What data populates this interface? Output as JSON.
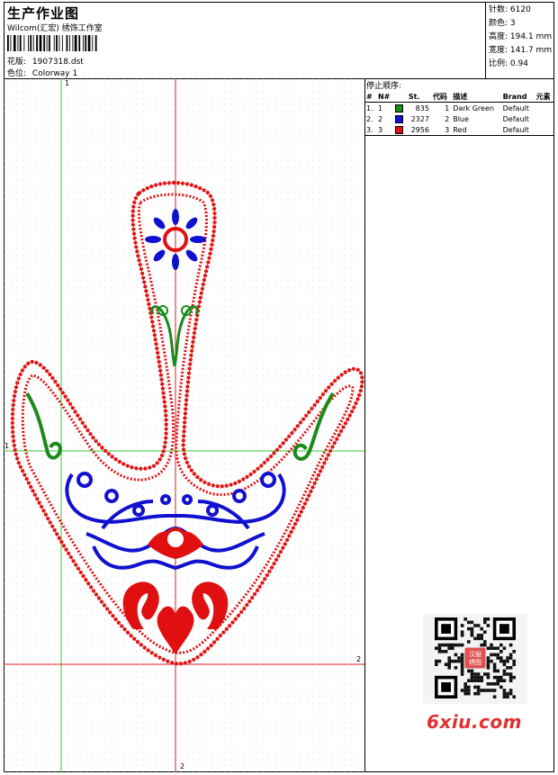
{
  "header": {
    "title": "生产作业图",
    "company": "Wilcom(汇宏) 绣饰工作室",
    "design_label": "花版:",
    "design_file": "1907318.dst",
    "colorway_label": "色位:",
    "colorway": "Colorway 1"
  },
  "stats": {
    "stitches_label": "针数:",
    "stitches": "6120",
    "colors_label": "颜色:",
    "colors": "3",
    "height_label": "高度:",
    "height": "194.1 mm",
    "width_label": "宽度:",
    "width": "141.7 mm",
    "scale_label": "比例:",
    "scale": "0.94"
  },
  "stop_sequence": {
    "title": "停止顺序:",
    "columns": [
      "#",
      "N#",
      "St.",
      "代码",
      "描述",
      "Brand",
      "元素"
    ],
    "rows": [
      {
        "index": "1.",
        "n": "1",
        "color": "#1a8a1a",
        "stitches": "835",
        "code": "1",
        "desc": "Dark Green",
        "brand": "Default",
        "element": ""
      },
      {
        "index": "2.",
        "n": "2",
        "color": "#1010d0",
        "stitches": "2327",
        "code": "2",
        "desc": "Blue",
        "brand": "Default",
        "element": ""
      },
      {
        "index": "3.",
        "n": "3",
        "color": "#e01010",
        "stitches": "2956",
        "code": "3",
        "desc": "Red",
        "brand": "Default",
        "element": ""
      }
    ]
  },
  "guides": {
    "v_green": "1",
    "h_green": "1",
    "v_red": "2",
    "h_red": "2"
  },
  "watermark": {
    "text": "6xiu.com",
    "qr_badge": "汉服\n绣图"
  },
  "colors": {
    "green_thread": "#1a8a1a",
    "blue_thread": "#1010d0",
    "red_thread": "#e01010",
    "guide_green": "#33cc33",
    "guide_red": "#dd2222"
  }
}
